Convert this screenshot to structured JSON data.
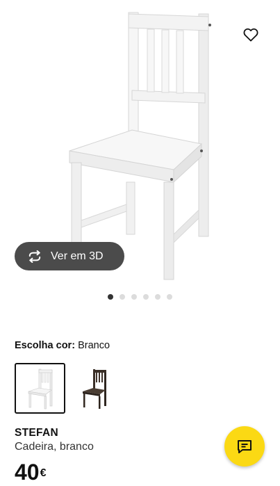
{
  "gallery": {
    "view_3d_label": "Ver em 3D",
    "dot_count": 6,
    "active_dot": 0,
    "image": "white-wooden-chair"
  },
  "favorite": {
    "icon": "heart-outline-icon"
  },
  "color_choice": {
    "label": "Escolha cor:",
    "value": "Branco",
    "options": [
      {
        "name": "white-chair-swatch",
        "selected": true
      },
      {
        "name": "dark-brown-chair-swatch",
        "selected": false
      }
    ]
  },
  "product": {
    "name": "STEFAN",
    "description": "Cadeira, branco",
    "price": "40",
    "currency": "€"
  },
  "chat": {
    "icon": "chat-bubble-icon"
  },
  "colors": {
    "accent": "#fbd914",
    "dark_button": "#4b4b4b",
    "text": "#111111"
  }
}
